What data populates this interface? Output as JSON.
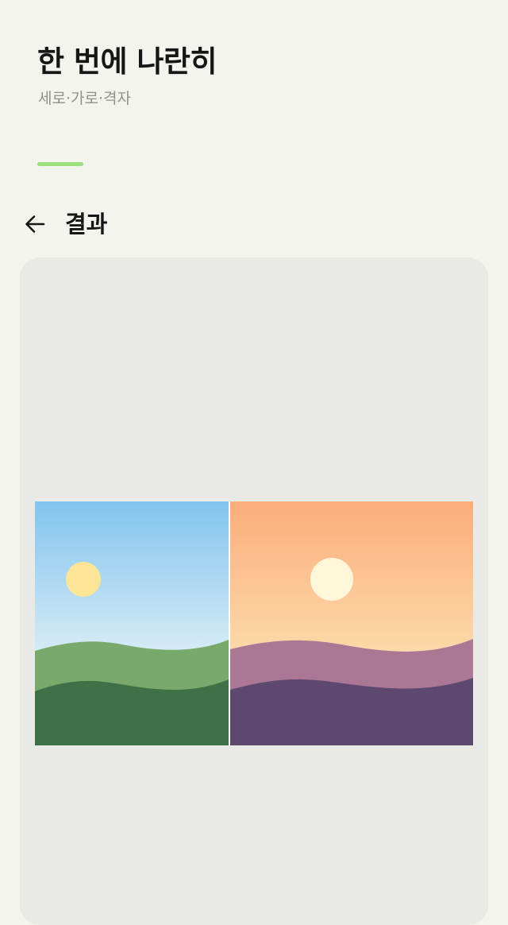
{
  "header": {
    "title": "한 번에 나란히",
    "subtitle": "세로·가로·격자"
  },
  "progress": {
    "steps_completed_fraction": 1.0,
    "color": "#9be07d"
  },
  "result": {
    "title": "결과",
    "back_icon": "arrow-left-icon"
  },
  "images": [
    {
      "name": "daytime-landscape",
      "sky_colors": [
        "#82c4ee",
        "#d6ebf6"
      ],
      "sun_color": "#fce596",
      "hill_colors": [
        "#79aa6b",
        "#3f7046"
      ]
    },
    {
      "name": "sunset-landscape",
      "sky_colors": [
        "#fbad7b",
        "#fdd9a9"
      ],
      "sun_color": "#fff6d9",
      "hill_colors": [
        "#ab7794",
        "#5d4870"
      ]
    }
  ],
  "colors": {
    "background": "#f3f4ee",
    "card": "#e9eae5",
    "text": "#161616",
    "muted": "#8f918c"
  }
}
